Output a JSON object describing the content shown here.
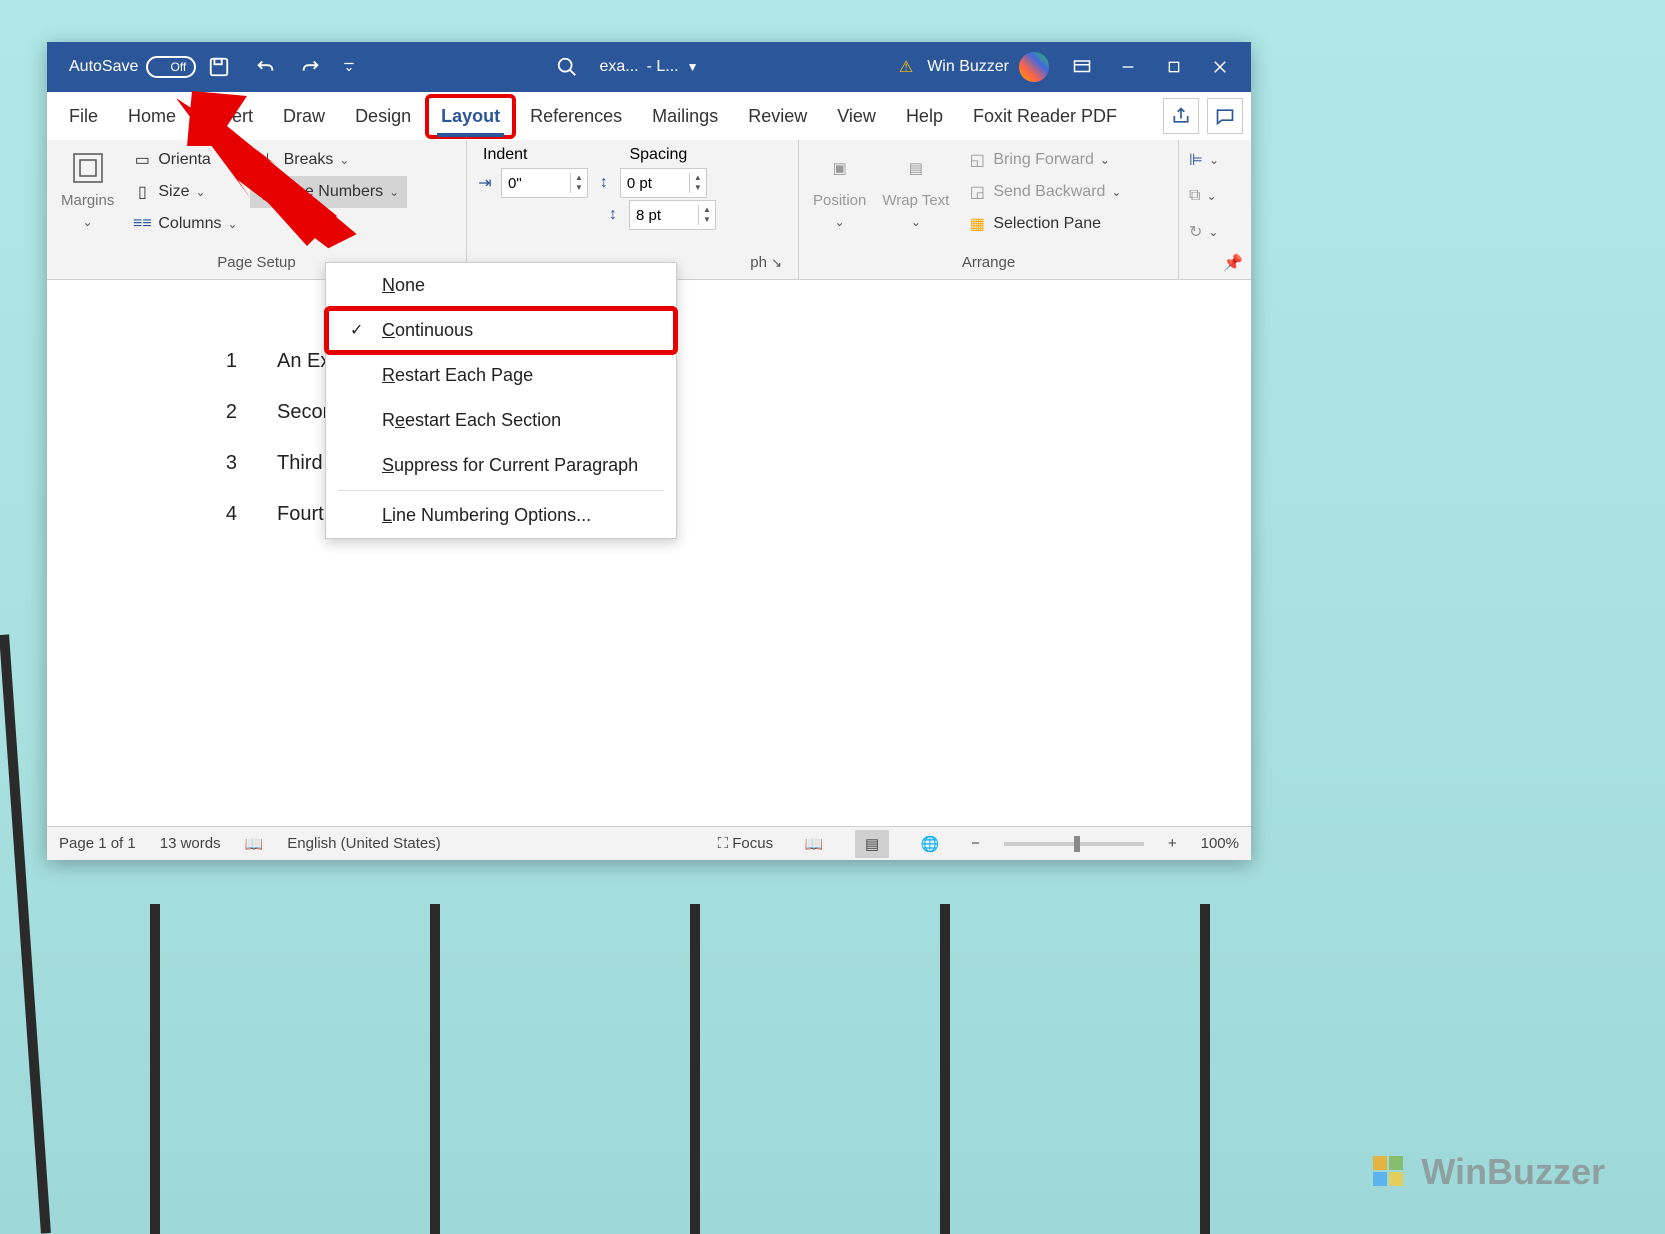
{
  "titlebar": {
    "autosave_label": "AutoSave",
    "autosave_state": "Off",
    "document_title": "exa...",
    "document_suffix": "- L...",
    "user_name": "Win Buzzer"
  },
  "tabs": {
    "file": "File",
    "home": "Home",
    "insert": "ert",
    "draw": "Draw",
    "design": "Design",
    "layout": "Layout",
    "references": "References",
    "mailings": "Mailings",
    "review": "Review",
    "view": "View",
    "help": "Help",
    "foxit": "Foxit Reader PDF"
  },
  "ribbon": {
    "page_setup": {
      "margins": "Margins",
      "orientation": "Orienta",
      "size": "Size",
      "columns": "Columns",
      "breaks": "Breaks",
      "line_numbers": "Line Numbers",
      "group_label": "Page Setup"
    },
    "paragraph": {
      "indent_label": "Indent",
      "spacing_label": "Spacing",
      "indent_left": "0\"",
      "spacing_before": "0 pt",
      "spacing_after": "8 pt",
      "group_label_suffix": "ph"
    },
    "arrange": {
      "position": "Position",
      "wrap_text": "Wrap Text",
      "bring_forward": "Bring Forward",
      "send_backward": "Send Backward",
      "selection_pane": "Selection Pane",
      "group_label": "Arrange"
    }
  },
  "dropdown": {
    "none": "one",
    "continuous": "ontinuous",
    "restart_page": "estart Each Page",
    "restart_section": "estart Each Section",
    "suppress": "uppress for Current Paragraph",
    "options": "ine Numbering Options..."
  },
  "document": {
    "lines": [
      {
        "num": "1",
        "text": "An Exa"
      },
      {
        "num": "2",
        "text": "Second"
      },
      {
        "num": "3",
        "text": "Third Li"
      },
      {
        "num": "4",
        "text": "Fourth"
      }
    ]
  },
  "statusbar": {
    "page": "Page 1 of 1",
    "words": "13 words",
    "language": "English (United States)",
    "focus": "Focus",
    "zoom": "100%"
  },
  "watermark": "WinBuzzer"
}
